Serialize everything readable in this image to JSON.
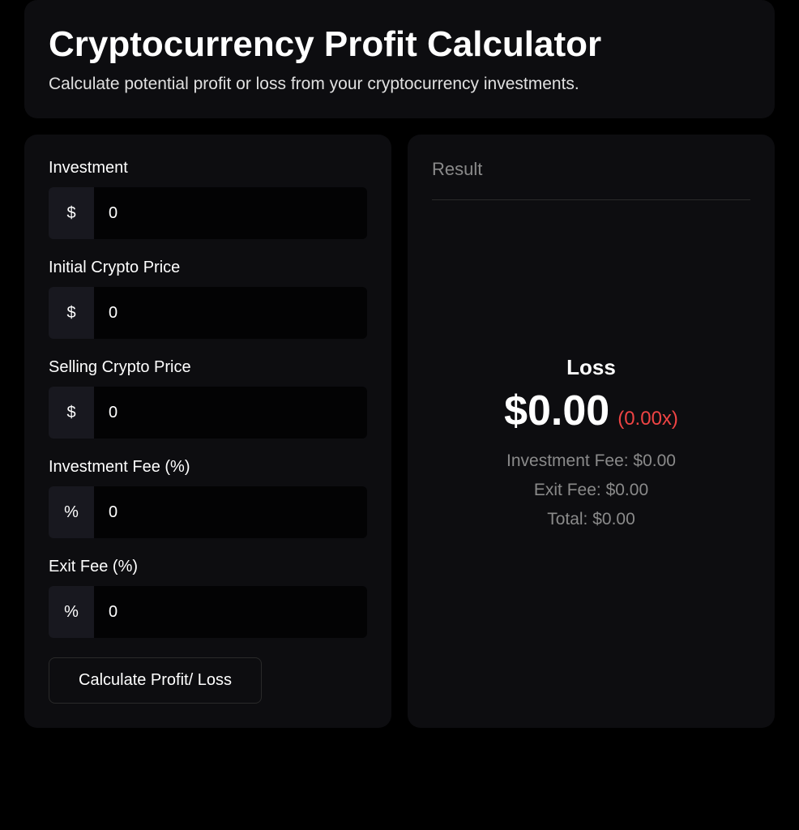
{
  "header": {
    "title": "Cryptocurrency Profit Calculator",
    "subtitle": "Calculate potential profit or loss from your cryptocurrency investments."
  },
  "form": {
    "investment": {
      "label": "Investment",
      "addon": "$",
      "value": "0"
    },
    "initial_price": {
      "label": "Initial Crypto Price",
      "addon": "$",
      "value": "0"
    },
    "selling_price": {
      "label": "Selling Crypto Price",
      "addon": "$",
      "value": "0"
    },
    "investment_fee": {
      "label": "Investment Fee (%)",
      "addon": "%",
      "value": "0"
    },
    "exit_fee": {
      "label": "Exit Fee (%)",
      "addon": "%",
      "value": "0"
    },
    "submit_label": "Calculate Profit/ Loss"
  },
  "result": {
    "heading": "Result",
    "status_label": "Loss",
    "amount": "$0.00",
    "multiplier": "(0.00x)",
    "investment_fee_line": "Investment Fee: $0.00",
    "exit_fee_line": "Exit Fee: $0.00",
    "total_line": "Total: $0.00"
  }
}
